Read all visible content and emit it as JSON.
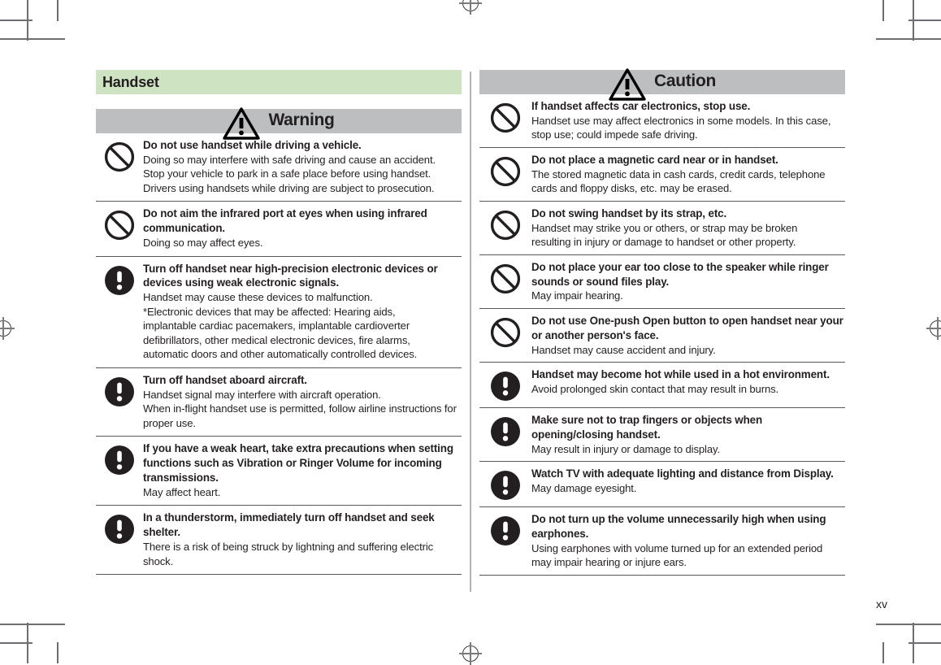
{
  "page": {
    "folio": "xv",
    "colors": {
      "section_header_bg": "#cde3c2",
      "band_bg": "#bcbec0",
      "rule": "#58595b",
      "text": "#231f20",
      "separator": "#b0b2b4"
    }
  },
  "left_column": {
    "section_title": "Handset",
    "band": {
      "label": "Warning",
      "icon": "warning-triangle-icon"
    },
    "items": [
      {
        "icon": "prohibition-icon",
        "heading": "Do not use handset while driving a vehicle.",
        "body": [
          "Doing so may interfere with safe driving and cause an accident.",
          "Stop your vehicle to park in a safe place before using handset.",
          "Drivers using handsets while driving are subject to prosecution."
        ]
      },
      {
        "icon": "prohibition-icon",
        "heading": "Do not aim the infrared port at eyes when using infrared communication.",
        "body": [
          "Doing so may affect eyes."
        ]
      },
      {
        "icon": "mandatory-exclamation-icon",
        "heading": "Turn off handset near high-precision electronic devices or devices using weak electronic signals.",
        "body": [
          "Handset may cause these devices to malfunction.",
          "*Electronic devices that may be affected: Hearing aids,",
          "implantable cardiac pacemakers, implantable cardioverter",
          "defibrillators, other medical electronic devices, fire alarms,",
          "automatic doors and other automatically controlled devices."
        ]
      },
      {
        "icon": "mandatory-exclamation-icon",
        "heading": "Turn off handset aboard aircraft.",
        "body": [
          "Handset signal may interfere with aircraft operation.",
          "When in-flight handset use is permitted, follow airline instructions for proper use."
        ]
      },
      {
        "icon": "mandatory-exclamation-icon",
        "heading": "If you have a weak heart, take extra precautions when setting functions such as Vibration or Ringer Volume for incoming transmissions.",
        "body": [
          "May affect heart."
        ]
      },
      {
        "icon": "mandatory-exclamation-icon",
        "heading": "In a thunderstorm, immediately turn off handset and seek shelter.",
        "body": [
          "There is a risk of being struck by lightning and suffering electric shock."
        ]
      }
    ]
  },
  "right_column": {
    "band": {
      "label": "Caution",
      "icon": "warning-triangle-icon"
    },
    "items": [
      {
        "icon": "prohibition-icon",
        "heading": "If handset affects car electronics, stop use.",
        "body": [
          "Handset use may affect electronics in some models. In this case,",
          "stop use; could impede safe driving."
        ]
      },
      {
        "icon": "prohibition-icon",
        "heading": "Do not place a magnetic card near or in handset.",
        "body": [
          "The stored magnetic data in cash cards, credit cards, telephone",
          "cards and floppy disks, etc. may be erased."
        ]
      },
      {
        "icon": "prohibition-icon",
        "heading": "Do not swing handset by its strap, etc.",
        "body": [
          "Handset may strike you or others, or strap may be broken",
          "resulting in injury or damage to handset or other property."
        ]
      },
      {
        "icon": "prohibition-icon",
        "heading": "Do not place your ear too close to the speaker while ringer sounds or sound files play.",
        "body": [
          "May impair hearing."
        ]
      },
      {
        "icon": "prohibition-icon",
        "heading": "Do not use One-push Open button to open handset near your or another person's face.",
        "body": [
          "Handset may cause accident and injury."
        ]
      },
      {
        "icon": "mandatory-exclamation-icon",
        "heading": "Handset may become hot while used in a hot environment.",
        "body": [
          "Avoid prolonged skin contact that may result in burns."
        ]
      },
      {
        "icon": "mandatory-exclamation-icon",
        "heading": "Make sure not to trap fingers or objects when opening/closing handset.",
        "body": [
          "May result in injury or damage to display."
        ]
      },
      {
        "icon": "mandatory-exclamation-icon",
        "heading": "Watch TV with adequate lighting and distance from Display.",
        "body": [
          "May damage eyesight."
        ]
      },
      {
        "icon": "mandatory-exclamation-icon",
        "heading": "Do not turn up the volume unnecessarily high when using earphones.",
        "body": [
          "Using earphones with volume turned up for an extended period",
          "may impair hearing or injure ears."
        ]
      }
    ]
  }
}
